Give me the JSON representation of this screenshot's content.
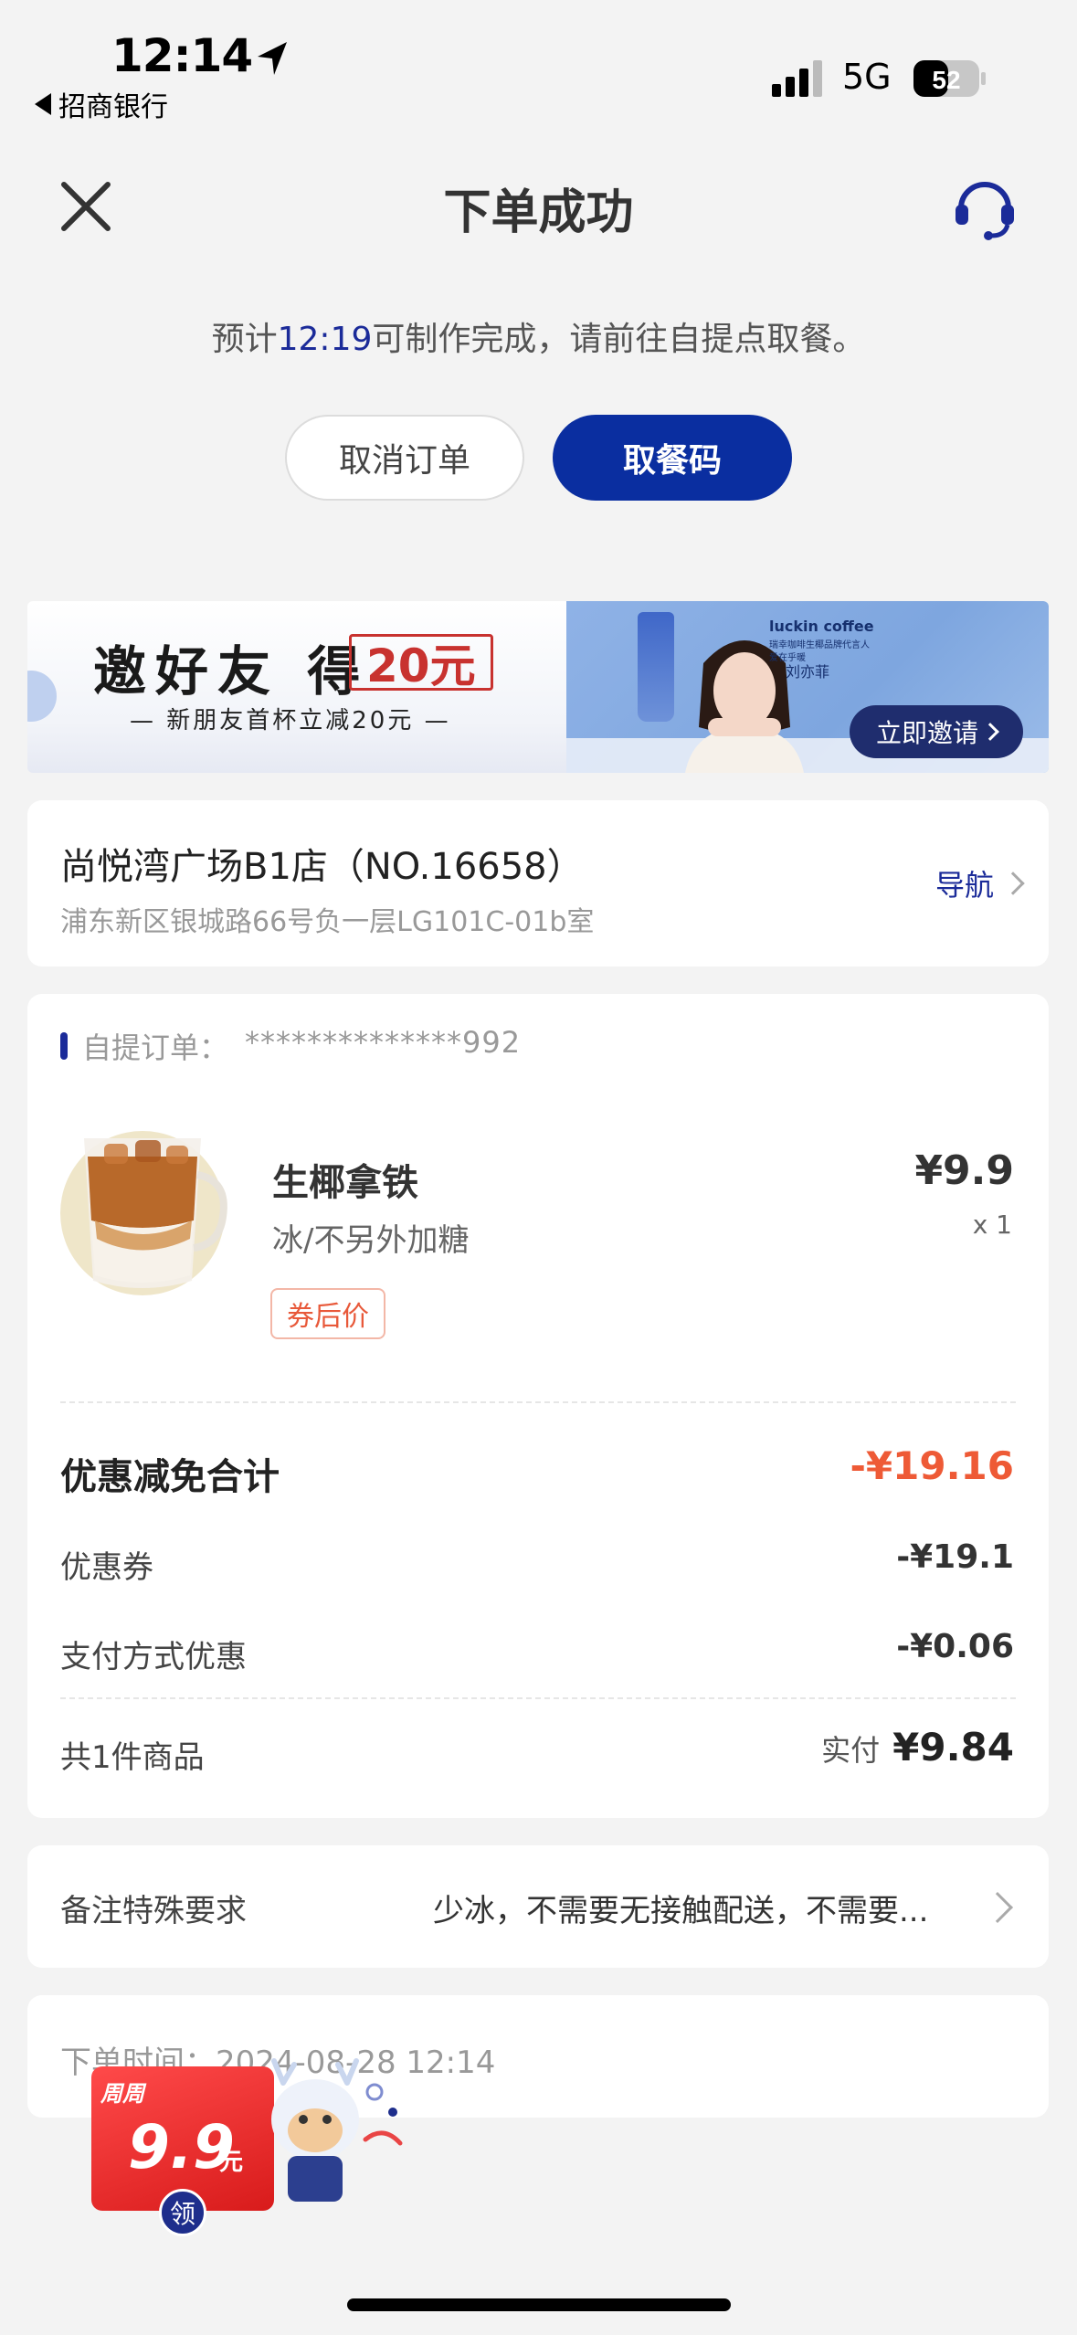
{
  "status_bar": {
    "time": "12:14",
    "back_app": "招商银行",
    "network": "5G",
    "battery": "52"
  },
  "header": {
    "title": "下单成功"
  },
  "notice": {
    "prefix": "预计",
    "time": "12:19",
    "suffix": "可制作完成，请前往自提点取餐。"
  },
  "actions": {
    "cancel_label": "取消订单",
    "pickup_code_label": "取餐码"
  },
  "banner": {
    "title": "邀好友 得",
    "amount": "20元",
    "subtitle": "— 新朋友首杯立减20元 —",
    "brand": "luckin coffee",
    "brand_sub": "瑞幸咖啡生椰品牌代言人",
    "brand_sub2": "爱在乎暖",
    "ambassador": "刘亦菲",
    "cta": "立即邀请"
  },
  "store": {
    "name": "尚悦湾广场B1店（NO.16658）",
    "address": "浦东新区银城路66号负一层LG101C-01b室",
    "nav_label": "导航"
  },
  "order": {
    "label": "自提订单：",
    "number": "**************992",
    "product": {
      "name": "生椰拿铁",
      "options": "冰/不另外加糖",
      "tag": "券后价",
      "price": "¥9.9",
      "qty": "x 1"
    },
    "discount_total_label": "优惠减免合计",
    "discount_total_value": "-¥19.16",
    "coupon_label": "优惠券",
    "coupon_value": "-¥19.1",
    "payment_discount_label": "支付方式优惠",
    "payment_discount_value": "-¥0.06",
    "items_count_label": "共1件商品",
    "paid_label": "实付",
    "paid_value": "¥9.84"
  },
  "remark": {
    "label": "备注特殊要求",
    "value": "少冰，不需要无接触配送，不需要..."
  },
  "order_time": {
    "label": "下单时间：2024-08-28 12:14"
  },
  "promo": {
    "tag": "周周",
    "price": "9.9",
    "unit": "元",
    "claim": "领"
  },
  "colors": {
    "brand_blue": "#0a2ea0",
    "discount_red": "#ee5a36"
  }
}
